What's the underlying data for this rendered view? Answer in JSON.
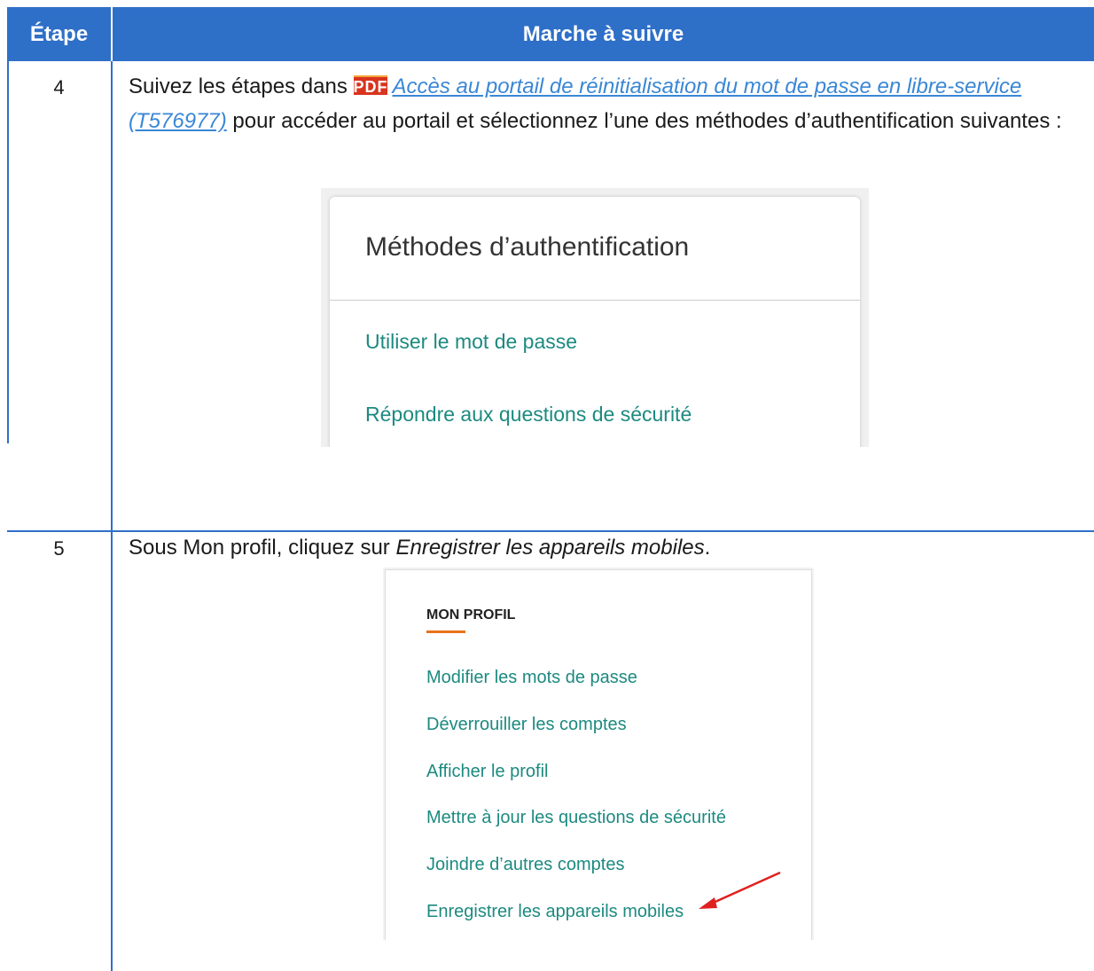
{
  "header": {
    "step_label": "Étape",
    "procedure_label": "Marche à suivre"
  },
  "rows": [
    {
      "step": "4",
      "text_before": "Suivez les étapes dans",
      "pdf_icon_label": "PDF",
      "link_text": "Accès au portail de réinitialisation du mot de passe en libre-service (T576977)",
      "text_after": " pour accéder au portail et sélectionnez l’une des méthodes d’authentification suivantes :",
      "screenshot": {
        "title": "Méthodes d’authentification",
        "options": [
          "Utiliser le mot de passe",
          "Répondre aux questions de sécurité"
        ]
      }
    },
    {
      "step": "5",
      "text_before": "Sous Mon profil, cliquez sur ",
      "emphasis": "Enregistrer les appareils mobiles",
      "text_after": ".",
      "screenshot": {
        "title": "MON PROFIL",
        "items": [
          "Modifier les mots de passe",
          "Déverrouiller les comptes",
          "Afficher le profil",
          "Mettre à jour les questions de sécurité",
          "Joindre d’autres comptes",
          "Enregistrer les appareils mobiles"
        ]
      }
    }
  ],
  "colors": {
    "header_bg": "#2e6fc8",
    "link": "#3a87d6",
    "teal_link": "#1c8a80",
    "pdf_icon": "#d8341e",
    "profile_underline": "#e8731c",
    "arrow": "#e02020"
  },
  "icons": [
    "pdf-icon",
    "red-arrow-icon"
  ]
}
